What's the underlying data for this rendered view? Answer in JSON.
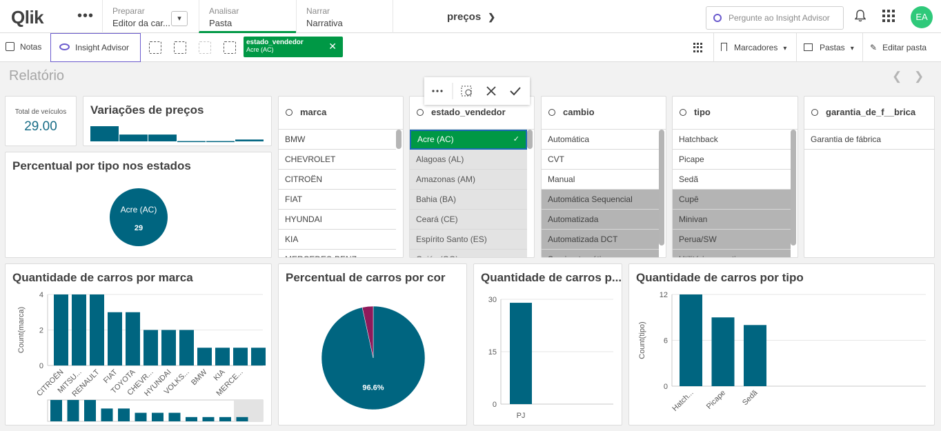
{
  "nav": {
    "logo": "Qlik",
    "more": "•••",
    "prepare": {
      "caption": "Preparar",
      "value": "Editor da car..."
    },
    "analyze": {
      "caption": "Analisar",
      "value": "Pasta"
    },
    "narrate": {
      "caption": "Narrar",
      "value": "Narrativa"
    },
    "app_name": "preços",
    "search_placeholder": "Pergunte ao Insight Advisor",
    "avatar": "EA"
  },
  "toolbar": {
    "notes": "Notas",
    "insight_advisor": "Insight Advisor",
    "selection": {
      "field": "estado_vendedor",
      "value": "Acre (AC)"
    },
    "bookmarks": "Marcadores",
    "sheets": "Pastas",
    "edit": "Editar pasta"
  },
  "sheet": {
    "title": "Relatório"
  },
  "kpi": {
    "label": "Total de veículos",
    "value": "29.00"
  },
  "variacoes": {
    "title": "Variações de preços",
    "bars": [
      1.0,
      0.45,
      0.45,
      0.02,
      0.02,
      0.12
    ]
  },
  "filters": [
    {
      "field": "marca",
      "items": [
        {
          "label": "BMW",
          "state": "possible"
        },
        {
          "label": "CHEVROLET",
          "state": "possible"
        },
        {
          "label": "CITROËN",
          "state": "possible"
        },
        {
          "label": "FIAT",
          "state": "possible"
        },
        {
          "label": "HYUNDAI",
          "state": "possible"
        },
        {
          "label": "KIA",
          "state": "possible"
        },
        {
          "label": "MERCEDES-BENZ",
          "state": "possible"
        }
      ]
    },
    {
      "field": "estado_vendedor",
      "items": [
        {
          "label": "Acre (AC)",
          "state": "selected"
        },
        {
          "label": "Alagoas (AL)",
          "state": "alternative"
        },
        {
          "label": "Amazonas (AM)",
          "state": "alternative"
        },
        {
          "label": "Bahia (BA)",
          "state": "alternative"
        },
        {
          "label": "Ceará (CE)",
          "state": "alternative"
        },
        {
          "label": "Espírito Santo (ES)",
          "state": "alternative"
        },
        {
          "label": "Goiás (GO)",
          "state": "alternative"
        }
      ]
    },
    {
      "field": "cambio",
      "items": [
        {
          "label": "Automática",
          "state": "possible"
        },
        {
          "label": "CVT",
          "state": "possible"
        },
        {
          "label": "Manual",
          "state": "possible"
        },
        {
          "label": "Automática Sequencial",
          "state": "excluded"
        },
        {
          "label": "Automatizada",
          "state": "excluded"
        },
        {
          "label": "Automatizada DCT",
          "state": "excluded"
        },
        {
          "label": "Semi-automática",
          "state": "excluded"
        }
      ]
    },
    {
      "field": "tipo",
      "items": [
        {
          "label": "Hatchback",
          "state": "possible"
        },
        {
          "label": "Picape",
          "state": "possible"
        },
        {
          "label": "Sedã",
          "state": "possible"
        },
        {
          "label": "Cupê",
          "state": "excluded"
        },
        {
          "label": "Minivan",
          "state": "excluded"
        },
        {
          "label": "Perua/SW",
          "state": "excluded"
        },
        {
          "label": "Utilitário esportivo",
          "state": "excluded"
        }
      ]
    },
    {
      "field": "garantia_de_f__brica",
      "items": [
        {
          "label": "Garantia de fábrica",
          "state": "possible"
        }
      ]
    }
  ],
  "chart_data": [
    {
      "type": "pie",
      "title": "Percentual por tipo nos estados",
      "categories": [
        "Acre (AC)"
      ],
      "values": [
        29
      ]
    },
    {
      "type": "bar",
      "title": "Quantidade de carros por marca",
      "ylabel": "Count(marca)",
      "ylim": [
        0,
        4
      ],
      "yticks": [
        0,
        2,
        4
      ],
      "categories": [
        "CITROËN",
        "MITSU...",
        "RENAULT",
        "FIAT",
        "TOYOTA",
        "CHEVR...",
        "HYUNDAI",
        "VOLKS...",
        "BMW",
        "KIA",
        "MERCE...",
        ""
      ],
      "values": [
        5,
        5,
        5,
        3,
        3,
        2,
        2,
        2,
        1,
        1,
        1,
        1
      ],
      "minimap": [
        5,
        5,
        5,
        3,
        3,
        2,
        2,
        2,
        1,
        1,
        1,
        1
      ]
    },
    {
      "type": "pie",
      "title": "Percentual de carros por cor",
      "categories": [
        "",
        ""
      ],
      "values": [
        96.6,
        3.4
      ],
      "labels": [
        "96.6%",
        ""
      ],
      "colors": [
        "#006580",
        "#8e1a5b"
      ]
    },
    {
      "type": "bar",
      "title": "Quantidade de carros p...",
      "ylim": [
        0,
        30
      ],
      "yticks": [
        0,
        15,
        30
      ],
      "categories": [
        "PJ"
      ],
      "values": [
        29
      ]
    },
    {
      "type": "bar",
      "title": "Quantidade de carros por tipo",
      "ylabel": "Count(tipo)",
      "ylim": [
        0,
        12
      ],
      "yticks": [
        0,
        6,
        12
      ],
      "categories": [
        "Hatch...",
        "Picape",
        "Sedã"
      ],
      "values": [
        12,
        9,
        8
      ]
    }
  ],
  "colors": {
    "bar": "#006580",
    "selected": "#009845",
    "insight": "#6a5acd"
  }
}
